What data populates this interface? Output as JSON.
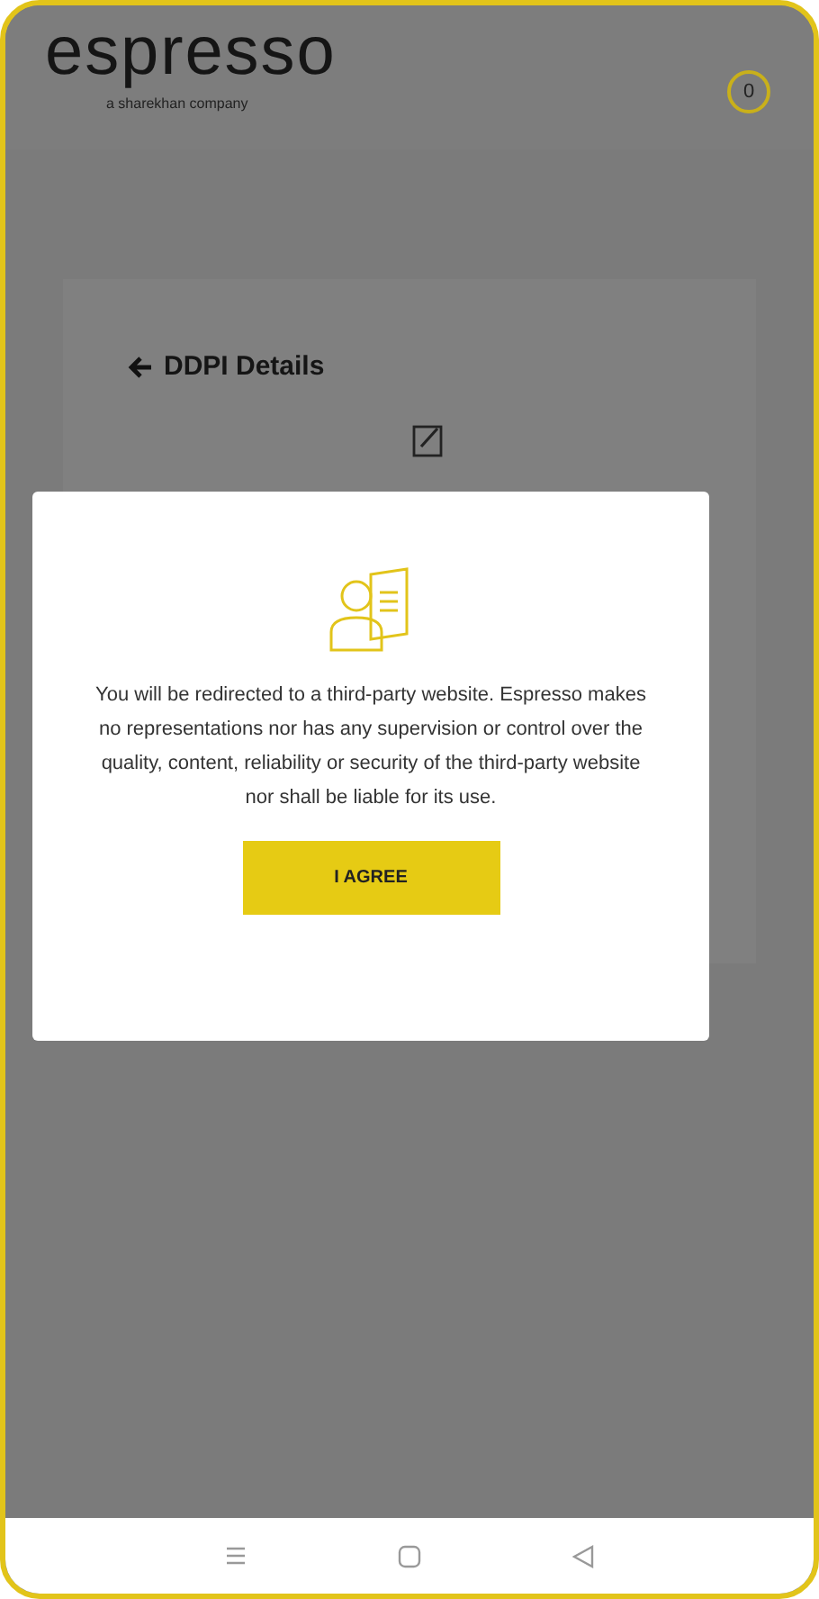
{
  "header": {
    "logo": "espresso",
    "tagline": "a sharekhan company",
    "badge": "0"
  },
  "page": {
    "title": "DDPI Details"
  },
  "dialog": {
    "message": "You will be redirected to a third-party website. Espresso makes no representations nor has any supervision or control over the quality, content, reliability or security of the third-party website nor shall be liable for its use.",
    "button": "I AGREE"
  }
}
